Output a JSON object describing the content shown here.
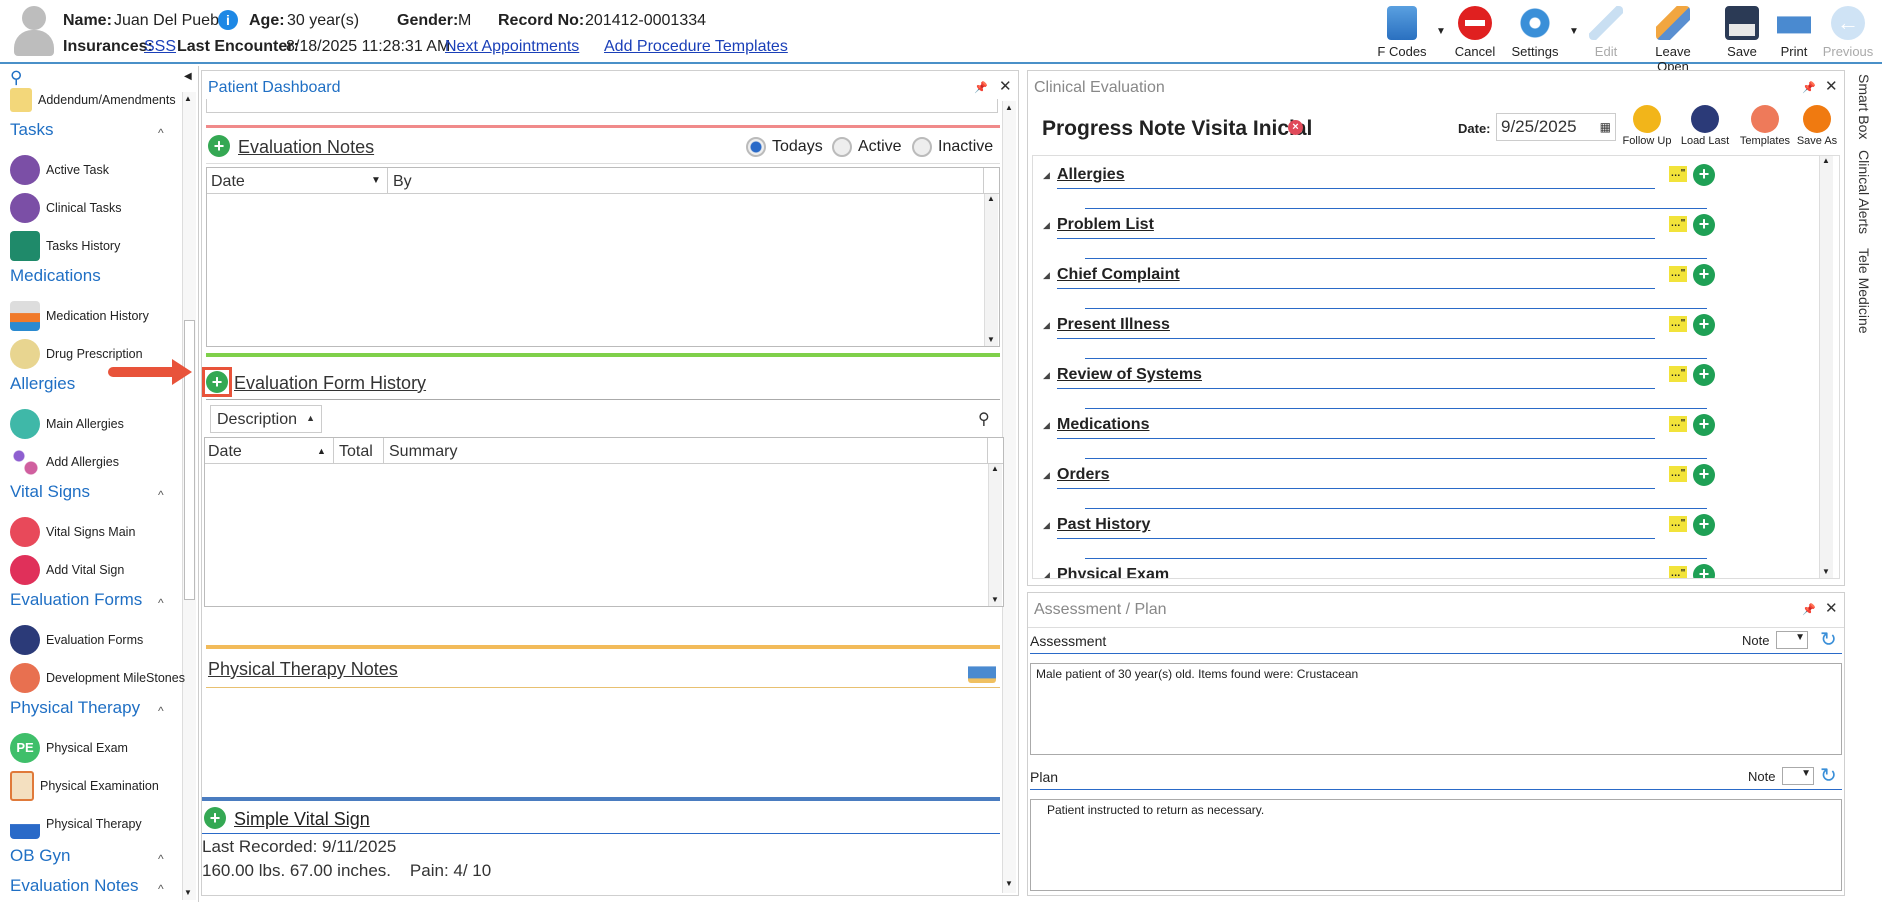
{
  "header": {
    "name_label": "Name:",
    "name_value": "Juan Del Pueblo",
    "age_label": "Age:",
    "age_value": "30 year(s)",
    "gender_label": "Gender:",
    "gender_value": "M",
    "record_label": "Record No:",
    "record_value": "201412-0001334",
    "insurances_label": "Insurances:",
    "insurances_value": "SSS",
    "last_encounter_label": "Last Encounter:",
    "last_encounter_value": "8/18/2025 11:28:31 AM",
    "next_appointments": "Next Appointments",
    "add_procedure_templates": "Add Procedure Templates"
  },
  "toolbar": {
    "fcodes": "F Codes",
    "cancel": "Cancel",
    "settings": "Settings",
    "edit": "Edit",
    "leave_open": "Leave Open",
    "save": "Save",
    "print": "Print",
    "previous": "Previous"
  },
  "sidebar": {
    "addendum": "Addendum/Amendments",
    "tasks": "Tasks",
    "active_task": "Active Task",
    "clinical_tasks": "Clinical Tasks",
    "tasks_history": "Tasks History",
    "medications": "Medications",
    "medication_history": "Medication History",
    "drug_prescription": "Drug Prescription",
    "allergies": "Allergies",
    "main_allergies": "Main Allergies",
    "add_allergies": "Add Allergies",
    "vital_signs": "Vital Signs",
    "vital_signs_main": "Vital Signs Main",
    "add_vital_sign": "Add Vital Sign",
    "evaluation_forms": "Evaluation Forms",
    "evaluation_forms_item": "Evaluation Forms",
    "development_milestones": "Development MileStones",
    "physical_therapy": "Physical Therapy",
    "physical_exam": "Physical Exam",
    "physical_examination": "Physical Examination",
    "physical_therapy_item": "Physical Therapy",
    "ob_gyn": "OB Gyn",
    "evaluation_notes": "Evaluation Notes",
    "pe_badge": "PE"
  },
  "dashboard": {
    "title": "Patient Dashboard",
    "evaluation_notes": "Evaluation Notes",
    "radio_todays": "Todays",
    "radio_active": "Active",
    "radio_inactive": "Inactive",
    "col_date": "Date",
    "col_by": "By",
    "eval_form_history": "Evaluation Form History",
    "description": "Description",
    "col_date2": "Date",
    "col_total": "Total",
    "col_summary": "Summary",
    "physical_therapy_notes": "Physical Therapy Notes",
    "simple_vital_sign": "Simple Vital Sign",
    "last_recorded": "Last Recorded: 9/11/2025",
    "vitals_line": "160.00 lbs. 67.00 inches.    Pain: 4/ 10"
  },
  "clinical": {
    "title": "Clinical Evaluation",
    "note_title": "Progress Note Visita Inicial",
    "date_label": "Date:",
    "date_value": "9/25/2025",
    "follow_up": "Follow Up",
    "load_last": "Load Last",
    "templates": "Templates",
    "save_as": "Save As",
    "sections": [
      "Allergies",
      "Problem List",
      "Chief Complaint",
      "Present Illness",
      "Review of Systems",
      "Medications",
      "Orders",
      "Past History",
      "Physical Exam"
    ]
  },
  "assessment": {
    "title": "Assessment / Plan",
    "assessment_label": "Assessment",
    "note_label": "Note",
    "assessment_text": "Male patient of 30 year(s) old. Items found were:  Crustacean",
    "plan_label": "Plan",
    "plan_note_label": "Note",
    "plan_text": "Patient instructed to return as necessary."
  },
  "right_tabs": {
    "smart_box": "Smart Box",
    "clinical_alerts": "Clinical Alerts",
    "tele_medicine": "Tele Medicine"
  }
}
